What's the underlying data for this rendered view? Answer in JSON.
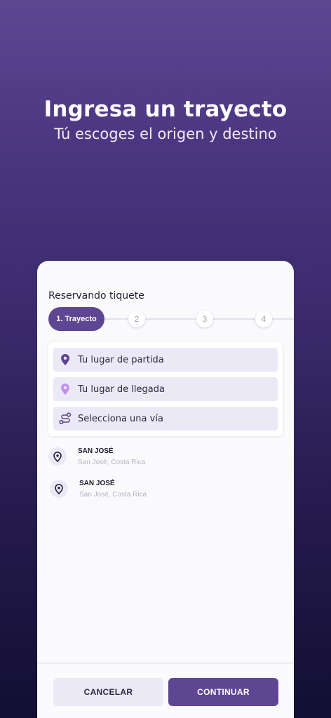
{
  "hero": {
    "title": "Ingresa un trayecto",
    "subtitle": "Tú escoges el origen y destino"
  },
  "card": {
    "title": "Reservando tiquete"
  },
  "stepper": {
    "active_label": "1. Trayecto",
    "steps": [
      "2",
      "3",
      "4"
    ]
  },
  "form": {
    "departure_placeholder": "Tu lugar de partida",
    "arrival_placeholder": "Tu lugar de llegada",
    "route_placeholder": "Selecciona una vía"
  },
  "locations": [
    {
      "name": "SAN JOSÉ",
      "detail": "San José, Costa Rica"
    },
    {
      "name": "SAN JOSÉ",
      "detail": "San José, Costa Rica"
    }
  ],
  "footer": {
    "cancel_label": "CANCELAR",
    "continue_label": "CONTINUAR"
  },
  "colors": {
    "accent": "#5e4693",
    "field_bg": "#ebe9f6",
    "pin_light": "#c48ff0"
  }
}
